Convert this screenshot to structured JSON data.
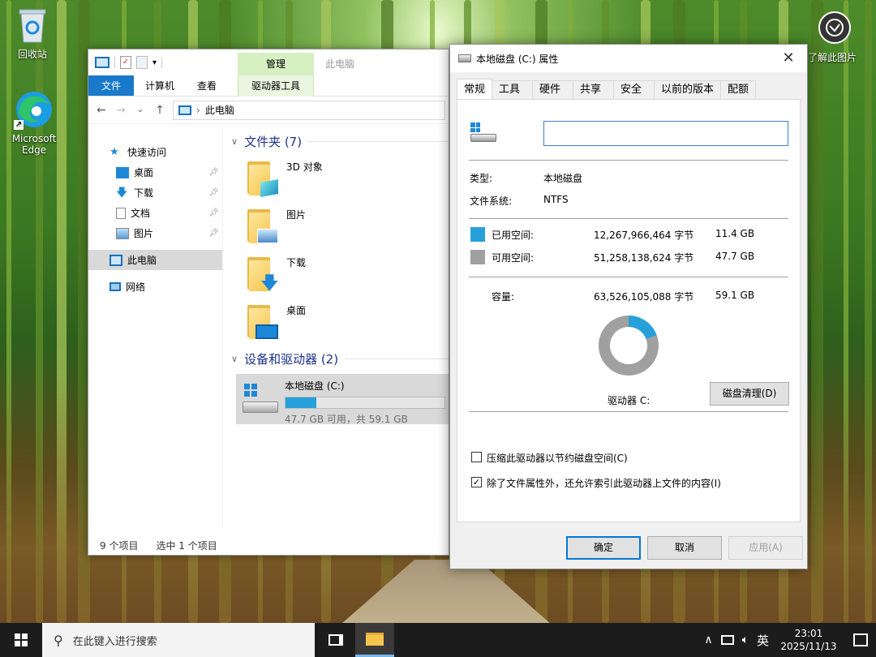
{
  "desktop": {
    "icons": [
      {
        "label": "回收站"
      },
      {
        "label": "Microsoft Edge"
      }
    ],
    "help": {
      "label": "了解此图片"
    }
  },
  "explorer": {
    "context_group_title": "管理",
    "window_title": "此电脑",
    "ribbon_tabs": {
      "file": "文件",
      "computer": "计算机",
      "view": "查看",
      "drive_tools": "驱动器工具"
    },
    "address": {
      "path": "此电脑"
    },
    "nav": {
      "quick_access": "快速访问",
      "desktop": "桌面",
      "downloads": "下载",
      "documents": "文档",
      "pictures": "图片",
      "this_pc": "此电脑",
      "network": "网络"
    },
    "groups": {
      "folders": "文件夹 (7)",
      "devices": "设备和驱动器 (2)"
    },
    "folders": [
      {
        "name": "3D 对象"
      },
      {
        "name": "图片"
      },
      {
        "name": "下载"
      },
      {
        "name": "桌面"
      }
    ],
    "drive": {
      "name": "本地磁盘 (C:)",
      "free_text": "47.7 GB 可用，共 59.1 GB",
      "used_fraction": 0.193
    },
    "status": {
      "count": "9 个项目",
      "selected": "选中 1 个项目"
    }
  },
  "dialog": {
    "title": "本地磁盘 (C:) 属性",
    "tabs": [
      "常规",
      "工具",
      "硬件",
      "共享",
      "安全",
      "以前的版本",
      "配额"
    ],
    "active_tab": "常规",
    "name_value": "",
    "type_label": "类型:",
    "type_value": "本地磁盘",
    "fs_label": "文件系统:",
    "fs_value": "NTFS",
    "used_label": "已用空间:",
    "used_bytes": "12,267,966,464 字节",
    "used_size": "11.4 GB",
    "free_label": "可用空间:",
    "free_bytes": "51,258,138,624 字节",
    "free_size": "47.7 GB",
    "capacity_label": "容量:",
    "capacity_bytes": "63,526,105,088 字节",
    "capacity_size": "59.1 GB",
    "drive_label": "驱动器 C:",
    "cleanup_button": "磁盘清理(D)",
    "compress_label": "压缩此驱动器以节约磁盘空间(C)",
    "compress_checked": false,
    "index_label": "除了文件属性外，还允许索引此驱动器上文件的内容(I)",
    "index_checked": true,
    "ok": "确定",
    "cancel": "取消",
    "apply": "应用(A)",
    "used_color": "#26a0da",
    "free_color": "#a0a0a0",
    "used_fraction": 0.193
  },
  "taskbar": {
    "search_placeholder": "在此键入进行搜索",
    "ime": "英",
    "time": "23:01",
    "date": "2025/11/13"
  }
}
